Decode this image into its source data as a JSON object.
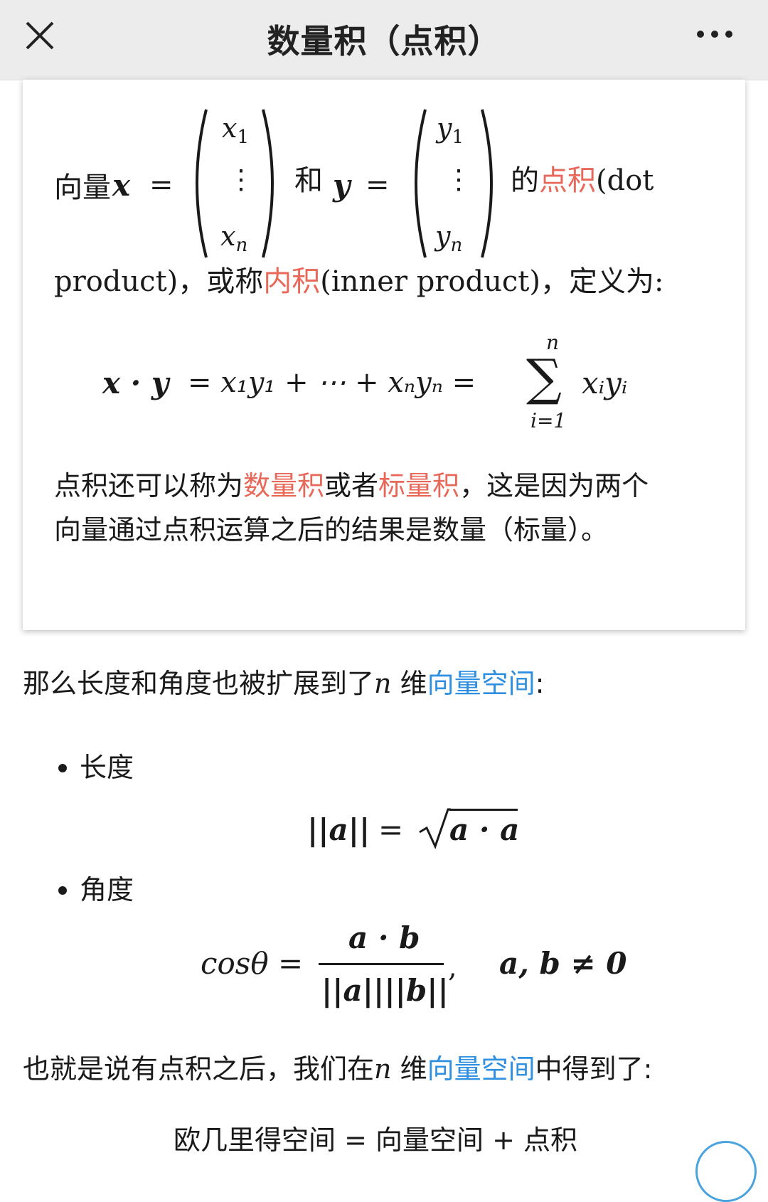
{
  "header": {
    "title": "数量积（点积）",
    "close_icon": "close-icon",
    "more_icon": "more-horizontal-icon"
  },
  "card": {
    "line1_prefix": "向量",
    "var_x": "x",
    "equals": "=",
    "and": "和",
    "var_y": "y",
    "de": "的",
    "dot_product_link": "点积",
    "line1_suffix": "(dot",
    "line2_start": "product)，或称",
    "inner_product_link": "内积",
    "line2_end": "(inner product)，定义为:",
    "matrix_x": {
      "top": "x",
      "top_sub": "1",
      "dots": "⋮",
      "bottom": "x",
      "bottom_sub": "n"
    },
    "matrix_y": {
      "top": "y",
      "top_sub": "1",
      "dots": "⋮",
      "bottom": "y",
      "bottom_sub": "n"
    },
    "formula": {
      "lhs": "x · y",
      "mid": "= x₁y₁ + ⋯ + xₙyₙ =",
      "sum_symbol": "∑",
      "sum_upper": "n",
      "sum_lower": "i=1",
      "rhs": "xᵢyᵢ"
    },
    "para_start": "点积还可以称为",
    "scalar_quantity_link": "数量积",
    "para_or": "或者",
    "scalar_link": "标量积",
    "para_end1": "，这是因为两个",
    "para_line2": "向量通过点积运算之后的结果是数量（标量）。"
  },
  "body": {
    "intro_start": "那么长度和角度也被扩展到了",
    "n": "n",
    "intro_mid": "维",
    "vector_space_link": "向量空间",
    "intro_end": ":",
    "bullet1": "长度",
    "length_formula_lhs": "||a||",
    "length_formula_eq": "=",
    "length_formula_rhs": "a · a",
    "bullet2": "角度",
    "angle_lhs": "cosθ =",
    "angle_num": "a · b",
    "angle_den": "||a||||b||",
    "angle_comma": ",",
    "angle_cond": "a, b ≠ 0",
    "conclusion_start": "也就是说有点积之后，我们在",
    "conclusion_n": "n",
    "conclusion_mid": "维",
    "conclusion_link": "向量空间",
    "conclusion_end": "中得到了:",
    "final_formula": "欧几里得空间 = 向量空间 + 点积"
  },
  "colors": {
    "link_red": "#e8685a",
    "link_blue": "#2f8fe0",
    "header_bg": "#ececec"
  }
}
